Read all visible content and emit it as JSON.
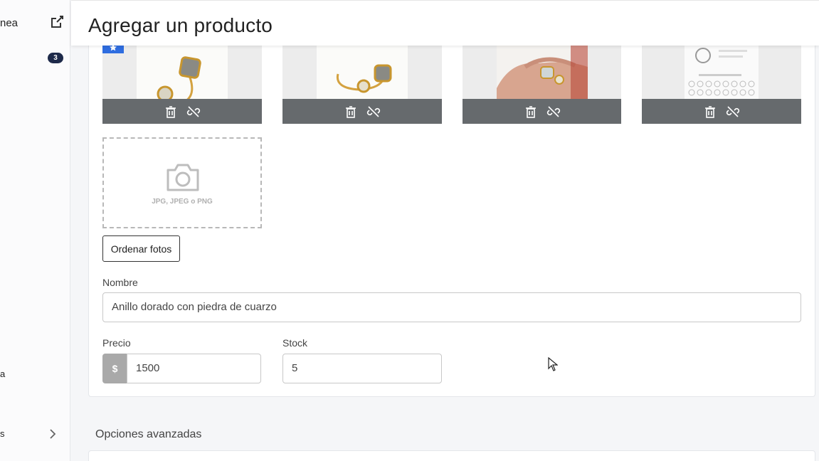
{
  "sidebar": {
    "item_top_label": "nea",
    "badge_count": "3",
    "item_mid_label": "a",
    "item_bottom_label": "s",
    "icons": [
      "external-link-icon",
      "chevron-right-icon"
    ]
  },
  "header": {
    "title": "Agregar un producto"
  },
  "photos": {
    "items": [
      {
        "name": "anillo-foto-1",
        "main": true
      },
      {
        "name": "anillo-foto-2",
        "main": false
      },
      {
        "name": "anillo-foto-3",
        "main": false
      },
      {
        "name": "tabla-medidas",
        "main": false
      }
    ],
    "upload_hint": "JPG, JPEG o PNG",
    "order_button": "Ordenar fotos",
    "icons": [
      "trash-icon",
      "unlink-icon",
      "camera-icon",
      "star-icon"
    ]
  },
  "form": {
    "name_label": "Nombre",
    "name_value": "Anillo dorado con piedra de cuarzo",
    "price_label": "Precio",
    "price_prefix": "$",
    "price_value": "1500",
    "stock_label": "Stock",
    "stock_value": "5"
  },
  "advanced": {
    "title": "Opciones avanzadas"
  },
  "colors": {
    "accent": "#2e6de0",
    "badge": "#1e2a4a",
    "photo_bar": "#666a6d"
  }
}
